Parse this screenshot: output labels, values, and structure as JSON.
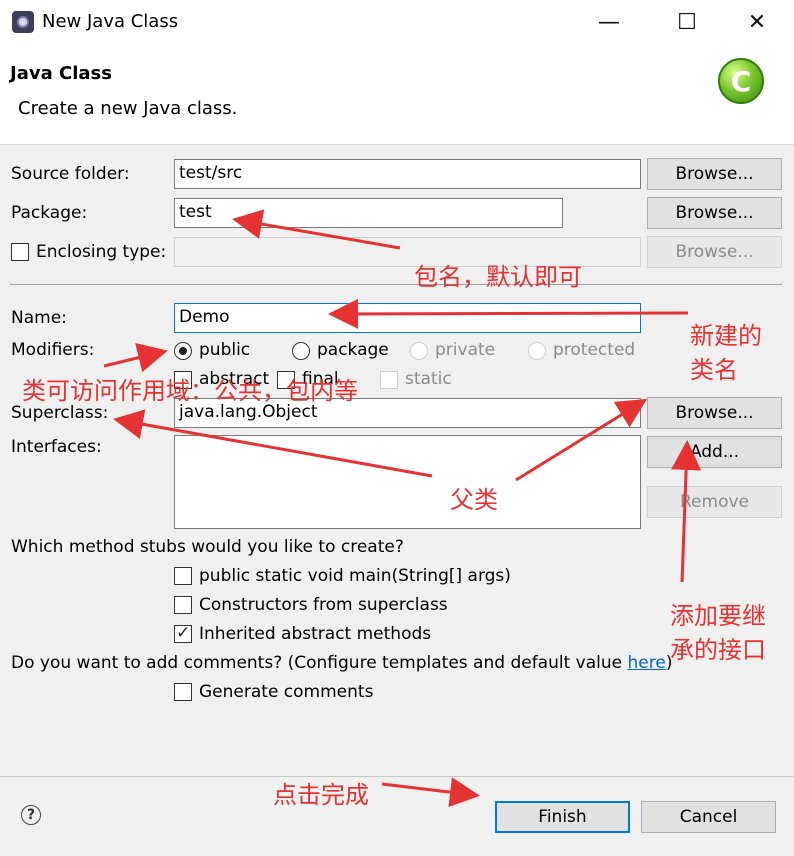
{
  "window": {
    "title": "New Java Class"
  },
  "header": {
    "title": "Java Class",
    "description": "Create a new Java class."
  },
  "source_folder": {
    "label": "Source folder:",
    "value": "test/src",
    "browse": "Browse..."
  },
  "package": {
    "label": "Package:",
    "value": "test",
    "browse": "Browse..."
  },
  "enclosing": {
    "label": "Enclosing type:",
    "value": "",
    "browse": "Browse...",
    "checked": false
  },
  "name": {
    "label": "Name:",
    "value": "Demo"
  },
  "modifiers": {
    "label": "Modifiers:",
    "radios": [
      "public",
      "package",
      "private",
      "protected"
    ],
    "selected": "public",
    "checks": [
      "abstract",
      "final",
      "static"
    ]
  },
  "superclass": {
    "label": "Superclass:",
    "value": "java.lang.Object",
    "browse": "Browse..."
  },
  "interfaces": {
    "label": "Interfaces:",
    "add": "Add...",
    "remove": "Remove"
  },
  "stubs": {
    "question": "Which method stubs would you like to create?",
    "items": [
      {
        "label": "public static void main(String[] args)",
        "checked": false
      },
      {
        "label": "Constructors from superclass",
        "checked": false
      },
      {
        "label": "Inherited abstract methods",
        "checked": true
      }
    ]
  },
  "comments": {
    "question": "Do you want to add comments? (Configure templates and default value ",
    "link": "here",
    "close_paren": ")",
    "generate": {
      "label": "Generate comments",
      "checked": false
    }
  },
  "footer": {
    "finish": "Finish",
    "cancel": "Cancel",
    "help": "?"
  },
  "annotations": {
    "package_note": "包名，默认即可",
    "name_note_1": "新建的",
    "name_note_2": "类名",
    "modifier_note": "类可访问作用域：公共，包内等",
    "super_note": "父类",
    "iface_note_1": "添加要继",
    "iface_note_2": "承的接口",
    "finish_note": "点击完成"
  },
  "colors": {
    "annotation": "#e53232",
    "focus": "#0078d7",
    "link": "#0066cc"
  }
}
